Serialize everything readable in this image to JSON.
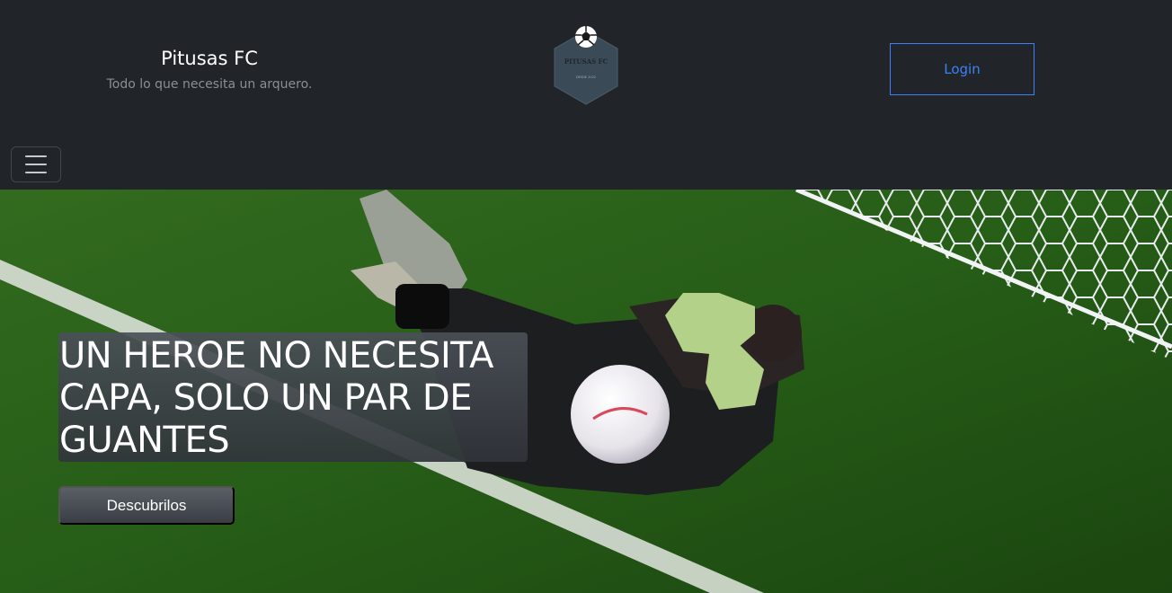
{
  "brand": {
    "title": "Pitusas FC",
    "tagline": "Todo lo que necesita un arquero.",
    "logo_text": "PITUSAS FC",
    "logo_subtext": "DESDE 2022"
  },
  "header": {
    "login_label": "Login"
  },
  "hero": {
    "heading": "UN HEROE NO NECESITA CAPA, SOLO UN PAR DE GUANTES",
    "cta_label": "Descubrilos"
  },
  "colors": {
    "header_bg": "#212529",
    "accent": "#3b82f6",
    "pitch_green": "#2f6a1f"
  }
}
